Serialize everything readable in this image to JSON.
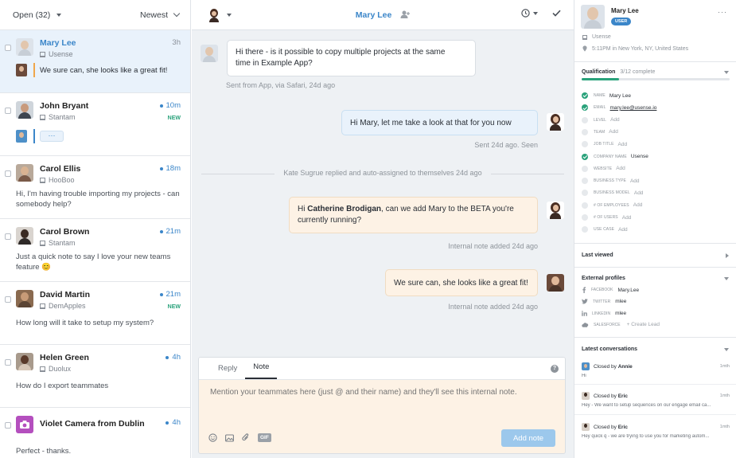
{
  "inbox": {
    "filter_label": "Open (32)",
    "sort_label": "Newest"
  },
  "conversations": [
    {
      "name": "Mary Lee",
      "company": "Usense",
      "time": "3h",
      "preview": "We sure can, she looks like a great fit!"
    },
    {
      "name": "John Bryant",
      "company": "Stantam",
      "time": "10m",
      "badge": "NEW",
      "preview": "···"
    },
    {
      "name": "Carol Ellis",
      "company": "HooBoo",
      "time": "18m",
      "preview": "Hi, I'm having trouble importing my projects - can somebody help?"
    },
    {
      "name": "Carol Brown",
      "company": "Stantam",
      "time": "21m",
      "preview": "Just a quick note to say I love your new teams feature 😊"
    },
    {
      "name": "David Martin",
      "company": "DemApples",
      "time": "21m",
      "badge": "NEW",
      "preview": "How long will it take to setup my system?"
    },
    {
      "name": "Helen Green",
      "company": "Duolux",
      "time": "4h",
      "preview": "How do I export teammates"
    },
    {
      "name": "Violet Camera from Dublin",
      "time": "4h",
      "preview": "Perfect - thanks."
    }
  ],
  "thread": {
    "title": "Mary Lee",
    "messages": [
      {
        "text_a": "Hi there - is it possible to copy multiple projects at the same",
        "text_b": "time in Example App?",
        "meta": "Sent from App, via Safari, 24d ago"
      },
      {
        "text_a": "Hi Mary, let me take a look at that for you now",
        "meta": "Sent 24d ago. Seen"
      },
      {
        "system": "Kate Sugrue replied and auto-assigned to themselves 24d ago"
      },
      {
        "pre": "Hi ",
        "mention": "Catherine Brodigan",
        "post": ", can we add Mary to the BETA you're",
        "line2": "currently running?",
        "meta": "Internal note added 24d ago"
      },
      {
        "text_a": "We sure can, she looks like a great fit!",
        "meta": "Internal note added 24d ago"
      }
    ]
  },
  "composer": {
    "tab_reply": "Reply",
    "tab_note": "Note",
    "placeholder": "Mention your teammates here (just @ and their name) and they'll see this internal note.",
    "gif_label": "GIF",
    "submit_label": "Add note"
  },
  "profile": {
    "name": "Mary Lee",
    "role_badge": "USER",
    "company": "Usense",
    "location": "5:11PM in New York, NY, United States",
    "qualification_title": "Qualification",
    "qualification_progress": "3/12 complete",
    "qualification_fraction": 0.25,
    "fields": [
      {
        "label": "NAME",
        "value": "Mary Lee",
        "done": true
      },
      {
        "label": "EMAIL",
        "value": "mary.lee@usense.io",
        "done": true
      },
      {
        "label": "LEVEL",
        "value": "Add",
        "done": false
      },
      {
        "label": "TEAM",
        "value": "Add",
        "done": false
      },
      {
        "label": "JOB TITLE",
        "value": "Add",
        "done": false
      },
      {
        "label": "COMPANY NAME",
        "value": "Usense",
        "done": true
      },
      {
        "label": "WEBSITE",
        "value": "Add",
        "done": false
      },
      {
        "label": "BUSINESS TYPE",
        "value": "Add",
        "done": false
      },
      {
        "label": "BUSINESS MODEL",
        "value": "Add",
        "done": false
      },
      {
        "label": "# OF EMPLOYEES",
        "value": "Add",
        "done": false
      },
      {
        "label": "# OF USERS",
        "value": "Add",
        "done": false
      },
      {
        "label": "USE CASE",
        "value": "Add",
        "done": false
      }
    ],
    "last_viewed_title": "Last viewed",
    "external_title": "External profiles",
    "external": [
      {
        "label": "FACEBOOK",
        "value": "Mary.Lee"
      },
      {
        "label": "TWITTER",
        "value": "mlee"
      },
      {
        "label": "LINKEDIN",
        "value": "mlee"
      },
      {
        "label": "SALESFORCE",
        "value": "+ Create Lead"
      }
    ],
    "latest_title": "Latest conversations",
    "latest": [
      {
        "closed_by": "Closed by ",
        "agent": "Annie",
        "time": "1mth",
        "preview": "Hi"
      },
      {
        "closed_by": "Closed by ",
        "agent": "Eric",
        "time": "1mth",
        "preview": "Hey - We want to setup sequences on our engage email ca..."
      },
      {
        "closed_by": "Closed by ",
        "agent": "Eric",
        "time": "1mth",
        "preview": "Hey quick q - we are trying to use you for marketing autom..."
      }
    ]
  },
  "colors": {
    "accent": "#3b86c9",
    "success": "#2aa27b",
    "note_bg": "#fdf2e5"
  }
}
